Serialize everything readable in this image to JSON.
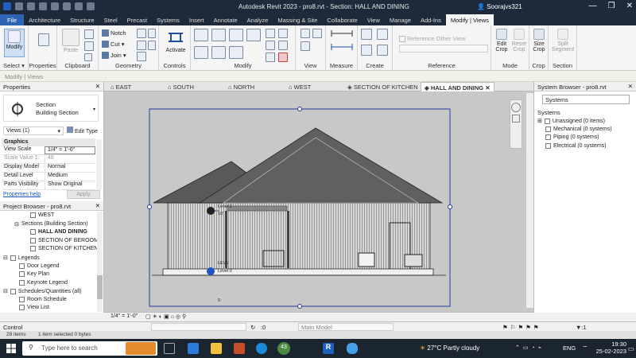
{
  "window": {
    "title": "Autodesk Revit 2023 - pro8.rvt - Section: HALL AND DINING",
    "user": "Soorajvs321",
    "controls": [
      "—",
      "❐",
      "✕"
    ]
  },
  "ribbon_tabs": [
    "File",
    "Architecture",
    "Structure",
    "Steel",
    "Precast",
    "Systems",
    "Insert",
    "Annotate",
    "Analyze",
    "Massing & Site",
    "Collaborate",
    "View",
    "Manage",
    "Add-Ins",
    "Modify | Views"
  ],
  "ribbon": {
    "modify_label": "Modify",
    "select_label": "Select ▾",
    "properties_label": "Properties",
    "paste_label": "Paste",
    "clipboard_label": "Clipboard",
    "notch_label": "Notch",
    "cut_label": "Cut ▾",
    "join_label": "Join ▾",
    "geometry_label": "Geometry",
    "activate_label": "Activate",
    "controls_label": "Controls",
    "modify_group_label": "Modify",
    "view_label": "View",
    "measure_label": "Measure",
    "create_label": "Create",
    "reference_other_view": "Reference Other View",
    "reference_label": "Reference",
    "edit_crop_label": "Edit Crop",
    "reset_crop_label": "Reset Crop",
    "size_crop_label": "Size Crop",
    "split_segment_label": "Split Segment",
    "mode_label": "Mode",
    "crop_label": "Crop",
    "section_label": "Section"
  },
  "options_bar": {
    "text": "Modify | Views"
  },
  "properties": {
    "header": "Properties",
    "type_line1": "Section",
    "type_line2": "Building Section",
    "views_count": "Views (1)",
    "edit_type": "Edit Type",
    "group": "Graphics",
    "rows": [
      {
        "k": "View Scale",
        "v": "1/4\" = 1'-0\""
      },
      {
        "k": "Scale Value  1:",
        "v": "48"
      },
      {
        "k": "Display Model",
        "v": "Normal"
      },
      {
        "k": "Detail Level",
        "v": "Medium"
      },
      {
        "k": "Parts Visibility",
        "v": "Show Original"
      }
    ],
    "help": "Properties help",
    "apply": "Apply"
  },
  "project_browser": {
    "header": "Project Browser - pro8.rvt",
    "items": [
      {
        "label": "WEST",
        "level": 3,
        "bold": false
      },
      {
        "label": "Sections (Building Section)",
        "level": 1,
        "bold": false
      },
      {
        "label": "HALL AND DINING",
        "level": 3,
        "bold": true
      },
      {
        "label": "SECTION OF BEROOM",
        "level": 3,
        "bold": false
      },
      {
        "label": "SECTION OF KITCHEN",
        "level": 3,
        "bold": false
      },
      {
        "label": "Legends",
        "level": 0,
        "bold": false
      },
      {
        "label": "Door Legend",
        "level": 2,
        "bold": false
      },
      {
        "label": "Key Plan",
        "level": 2,
        "bold": false
      },
      {
        "label": "Keynote Legend",
        "level": 2,
        "bold": false
      },
      {
        "label": "Schedules/Quantities (all)",
        "level": 0,
        "bold": false
      },
      {
        "label": "Room Schedule",
        "level": 2,
        "bold": false
      },
      {
        "label": "View List",
        "level": 2,
        "bold": false
      }
    ]
  },
  "view_tabs": [
    {
      "label": "EAST",
      "active": false
    },
    {
      "label": "SOUTH",
      "active": false
    },
    {
      "label": "NORTH",
      "active": false
    },
    {
      "label": "WEST",
      "active": false
    },
    {
      "label": "SECTION OF KITCHEN",
      "active": false
    },
    {
      "label": "HALL AND DINING",
      "active": true
    }
  ],
  "canvas": {
    "level2_label": "Level 2",
    "level2_value": "10'",
    "level1_label": "LEV1",
    "level1_sub": "Level 0",
    "level1_value": "0"
  },
  "system_browser": {
    "header": "System Browser - pro8.rvt",
    "dropdown": "Systems",
    "column": "Systems",
    "items": [
      "Unassigned (0 items)",
      "Mechanical (0 systems)",
      "Piping (0 systems)",
      "Electrical (0 systems)"
    ]
  },
  "view_control": {
    "scale": "1/4\" = 1'-0\"",
    "zero": ":0",
    "model": "Main Model",
    "filter": ":1"
  },
  "status": {
    "text": "Control",
    "items": "28 items",
    "selected": "1 item selected  0 bytes"
  },
  "taskbar": {
    "search_placeholder": "Type here to search",
    "badge": "43",
    "weather": "27°C  Partly cloudy",
    "lang": "ENG",
    "time": "19:30",
    "date": "25-02-2023"
  },
  "colors": {
    "ribbon_dark": "#1e2a3a",
    "file_blue": "#2e65b3",
    "canvas_bg": "#c8c8c8",
    "crop_blue": "#1e3c9c",
    "roof": "#5a5a5a"
  }
}
